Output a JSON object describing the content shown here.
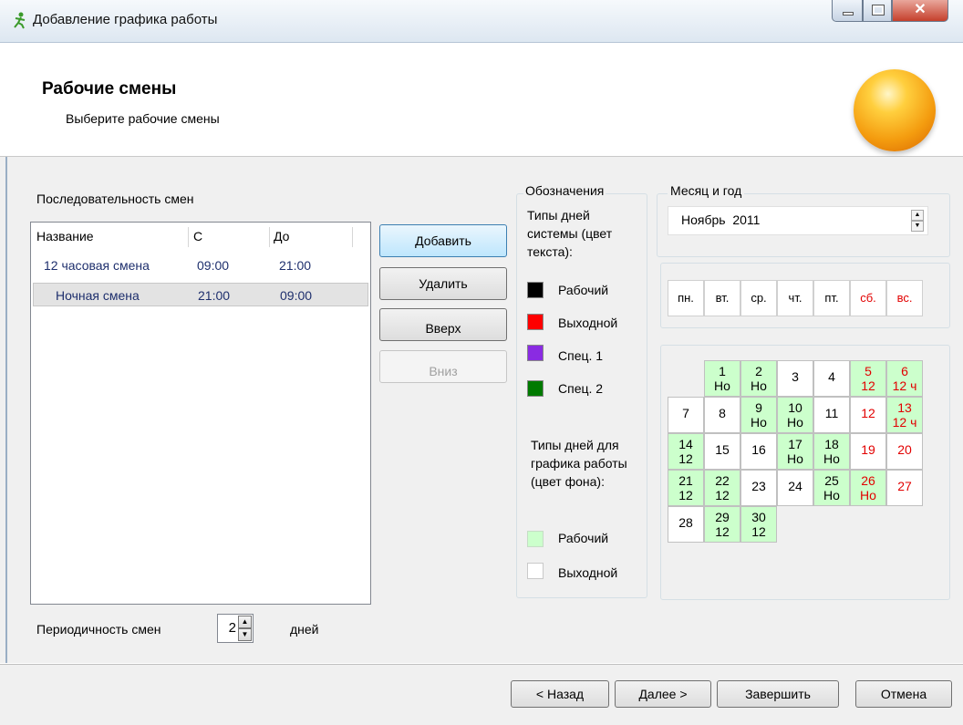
{
  "window": {
    "title": "Добавление графика работы"
  },
  "header": {
    "title": "Рабочие смены",
    "subtitle": "Выберите рабочие смены"
  },
  "sequence": {
    "label": "Последовательность смен",
    "columns": [
      "Название",
      "С",
      "До"
    ],
    "rows": [
      {
        "name": "12 часовая смена",
        "from": "09:00",
        "to": "21:00"
      },
      {
        "name": "Ночная смена",
        "from": "21:00",
        "to": "09:00"
      }
    ],
    "period_label": "Периодичность смен",
    "period_value": "2",
    "period_unit": "дней"
  },
  "actions": {
    "add": "Добавить",
    "remove": "Удалить",
    "up": "Вверх",
    "down": "Вниз"
  },
  "legend": {
    "title": "Обозначения",
    "system_types_label": "Типы дней системы (цвет текста):",
    "system_types": [
      {
        "label": "Рабочий",
        "color": "#000000"
      },
      {
        "label": "Выходной",
        "color": "#ff0000"
      },
      {
        "label": "Спец. 1",
        "color": "#8a2be2"
      },
      {
        "label": "Спец. 2",
        "color": "#007a00"
      }
    ],
    "schedule_types_label": "Типы дней для графика работы (цвет фона):",
    "schedule_types": [
      {
        "label": "Рабочий",
        "color": "#ccffcc"
      },
      {
        "label": "Выходной",
        "color": "#ffffff"
      }
    ]
  },
  "calendar": {
    "title": "Месяц и год",
    "month_value": "Ноябрь  2011",
    "weekdays": [
      "пн.",
      "вт.",
      "ср.",
      "чт.",
      "пт.",
      "сб.",
      "вс."
    ],
    "days": [
      {
        "d": "1",
        "s": "Но",
        "work": true,
        "red": false
      },
      {
        "d": "2",
        "s": "Но",
        "work": true,
        "red": false
      },
      {
        "d": "3",
        "s": "",
        "work": false,
        "red": false
      },
      {
        "d": "4",
        "s": "",
        "work": false,
        "red": false
      },
      {
        "d": "5",
        "s": "12",
        "work": true,
        "red": true
      },
      {
        "d": "6",
        "s": "12 ч",
        "work": true,
        "red": true
      },
      {
        "d": "7",
        "s": "",
        "work": false,
        "red": false
      },
      {
        "d": "8",
        "s": "",
        "work": false,
        "red": false
      },
      {
        "d": "9",
        "s": "Но",
        "work": true,
        "red": false
      },
      {
        "d": "10",
        "s": "Но",
        "work": true,
        "red": false
      },
      {
        "d": "11",
        "s": "",
        "work": false,
        "red": false
      },
      {
        "d": "12",
        "s": "",
        "work": false,
        "red": true
      },
      {
        "d": "13",
        "s": "12 ч",
        "work": true,
        "red": true
      },
      {
        "d": "14",
        "s": "12",
        "work": true,
        "red": false
      },
      {
        "d": "15",
        "s": "",
        "work": false,
        "red": false
      },
      {
        "d": "16",
        "s": "",
        "work": false,
        "red": false
      },
      {
        "d": "17",
        "s": "Но",
        "work": true,
        "red": false
      },
      {
        "d": "18",
        "s": "Но",
        "work": true,
        "red": false
      },
      {
        "d": "19",
        "s": "",
        "work": false,
        "red": true
      },
      {
        "d": "20",
        "s": "",
        "work": false,
        "red": true
      },
      {
        "d": "21",
        "s": "12",
        "work": true,
        "red": false
      },
      {
        "d": "22",
        "s": "12",
        "work": true,
        "red": false
      },
      {
        "d": "23",
        "s": "",
        "work": false,
        "red": false
      },
      {
        "d": "24",
        "s": "",
        "work": false,
        "red": false
      },
      {
        "d": "25",
        "s": "Но",
        "work": true,
        "red": false
      },
      {
        "d": "26",
        "s": "Но",
        "work": true,
        "red": true
      },
      {
        "d": "27",
        "s": "",
        "work": false,
        "red": true
      },
      {
        "d": "28",
        "s": "",
        "work": false,
        "red": false
      },
      {
        "d": "29",
        "s": "12",
        "work": true,
        "red": false
      },
      {
        "d": "30",
        "s": "12",
        "work": true,
        "red": false
      }
    ]
  },
  "footer": {
    "back": "< Назад",
    "next": "Далее >",
    "finish": "Завершить",
    "cancel": "Отмена"
  }
}
